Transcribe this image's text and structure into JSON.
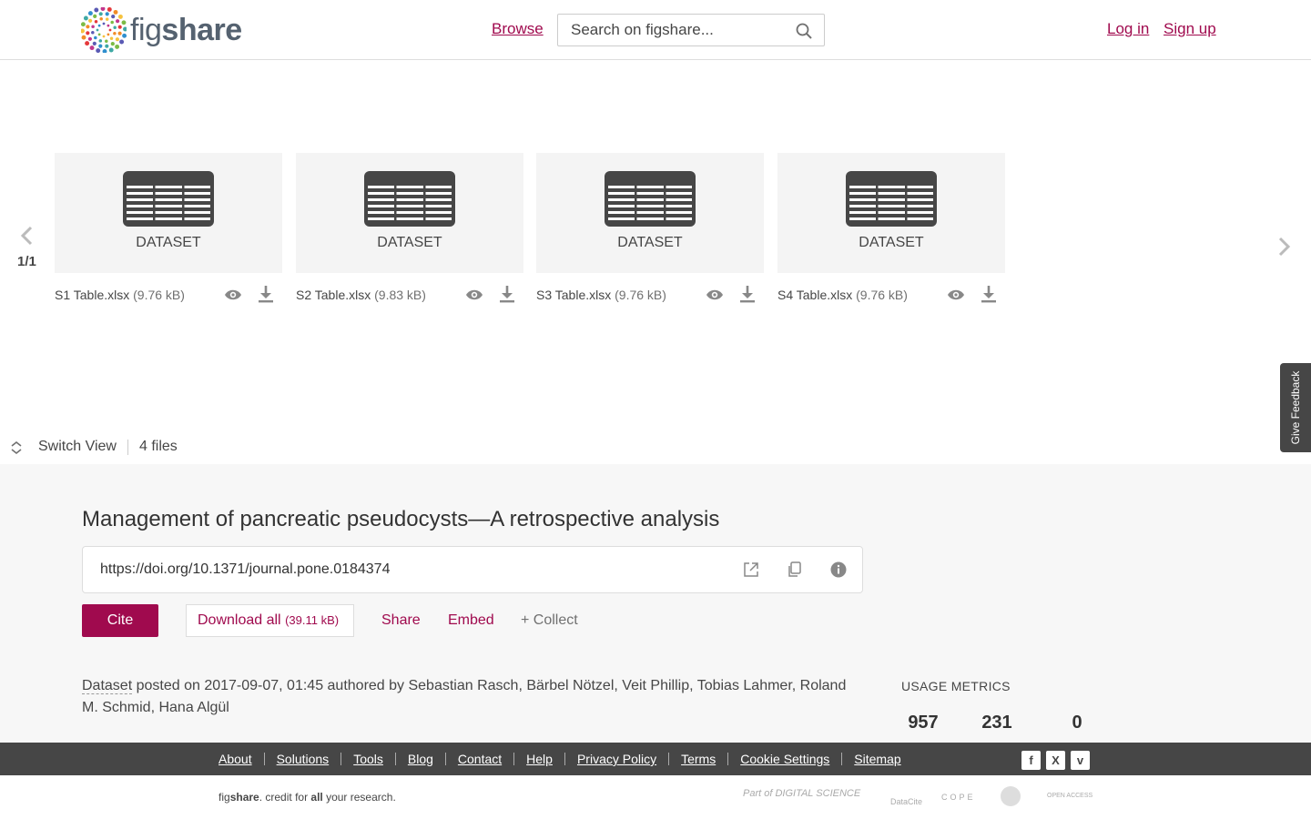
{
  "header": {
    "logo_fig": "fig",
    "logo_share": "share",
    "browse": "Browse",
    "search_placeholder": "Search on figshare...",
    "login": "Log in",
    "signup": "Sign up"
  },
  "carousel": {
    "page": "1/1",
    "files": [
      {
        "type": "DATASET",
        "name": "S1 Table.xlsx",
        "size": "(9.76 kB)"
      },
      {
        "type": "DATASET",
        "name": "S2 Table.xlsx",
        "size": "(9.83 kB)"
      },
      {
        "type": "DATASET",
        "name": "S3 Table.xlsx",
        "size": "(9.76 kB)"
      },
      {
        "type": "DATASET",
        "name": "S4 Table.xlsx",
        "size": "(9.76 kB)"
      }
    ]
  },
  "feedback": "Give Feedback",
  "view": {
    "switch_label": "Switch View",
    "files_count": "4 files"
  },
  "article": {
    "title": "Management of pancreatic pseudocysts—A retrospective analysis",
    "doi": "https://doi.org/10.1371/journal.pone.0184374",
    "cite": "Cite",
    "download_all": "Download all",
    "download_size": "(39.11 kB)",
    "share": "Share",
    "embed": "Embed",
    "collect": "+ Collect",
    "item_type": "Dataset",
    "posted_text": " posted on 2017-09-07, 01:45 authored by Sebastian Rasch, Bärbel Nötzel, Veit Phillip, Tobias Lahmer, Roland M. Schmid, Hana Algül"
  },
  "metrics": {
    "label": "USAGE METRICS",
    "values": [
      "957",
      "231",
      "0"
    ]
  },
  "footer": {
    "links": [
      "About",
      "Solutions",
      "Tools",
      "Blog",
      "Contact",
      "Help",
      "Privacy Policy",
      "Terms",
      "Cookie Settings",
      "Sitemap"
    ],
    "social_icons": [
      "facebook-icon",
      "x-icon",
      "vimeo-icon"
    ],
    "tagline_pre": "fig",
    "tagline_brand": "share",
    "tagline_mid": ". credit for ",
    "tagline_all": "all",
    "tagline_post": " your research.",
    "partners": [
      "Part of DIGITAL SCIENCE",
      "DataCite",
      "COPE",
      "OPEN ACCESS"
    ]
  },
  "colors": {
    "accent": "#a00a4e",
    "text": "#464646",
    "footer_bg": "#464646",
    "details_bg": "#f7f7f7"
  }
}
